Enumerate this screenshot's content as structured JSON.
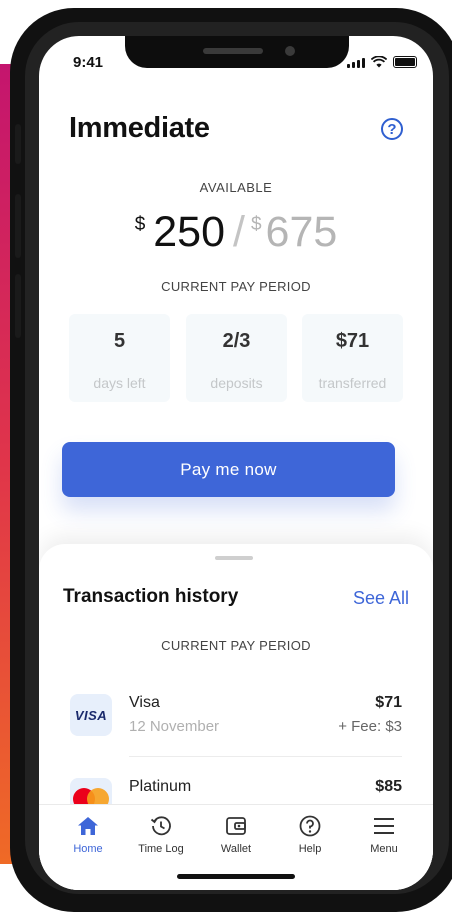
{
  "status_bar": {
    "time": "9:41"
  },
  "header": {
    "title": "Immediate",
    "help_icon": "question-circle-icon"
  },
  "balance": {
    "available_label": "AVAILABLE",
    "currency": "$",
    "available_amount": "250",
    "separator": "/",
    "total_amount": "675"
  },
  "pay_period": {
    "label": "CURRENT PAY PERIOD",
    "stats": [
      {
        "value": "5",
        "label": "days left"
      },
      {
        "value": "2/3",
        "label": "deposits"
      },
      {
        "value": "$71",
        "label": "transferred"
      }
    ]
  },
  "pay_button": {
    "label": "Pay me now",
    "color": "#3e66d8"
  },
  "transactions": {
    "title": "Transaction history",
    "see_all": "See All",
    "period_label": "CURRENT PAY PERIOD",
    "items": [
      {
        "logo": "VISA",
        "name": "Visa",
        "date": "12 November",
        "amount": "$71",
        "fee": "+ Fee: $3"
      },
      {
        "logo": "mastercard-logo",
        "name": "Platinum",
        "amount": "$85"
      }
    ]
  },
  "tabs": [
    {
      "label": "Home",
      "icon": "home-icon",
      "active": true
    },
    {
      "label": "Time Log",
      "icon": "history-icon",
      "active": false
    },
    {
      "label": "Wallet",
      "icon": "wallet-icon",
      "active": false
    },
    {
      "label": "Help",
      "icon": "question-circle-icon",
      "active": false
    },
    {
      "label": "Menu",
      "icon": "hamburger-menu-icon",
      "active": false
    }
  ]
}
